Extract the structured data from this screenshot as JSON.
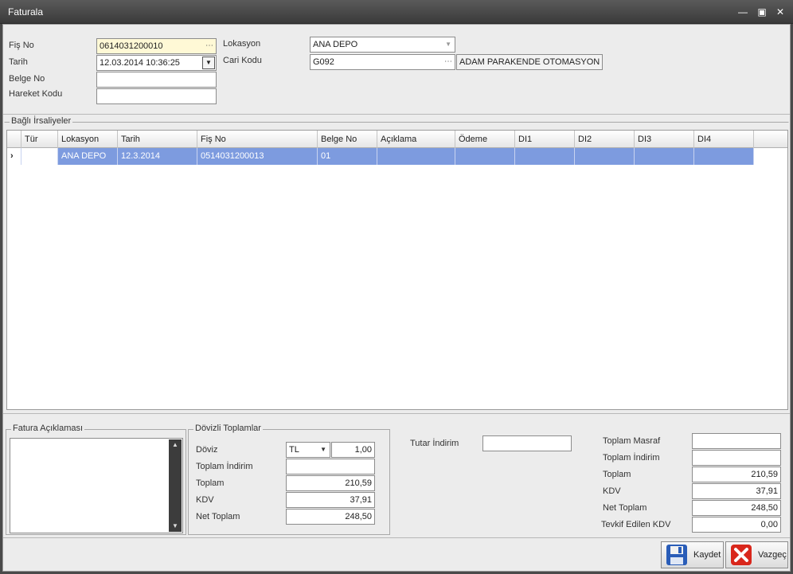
{
  "window": {
    "title": "Faturala"
  },
  "header": {
    "fis_no_label": "Fiş No",
    "fis_no_value": "0614031200010",
    "tarih_label": "Tarih",
    "tarih_value": "12.03.2014 10:36:25",
    "belge_no_label": "Belge No",
    "belge_no_value": "",
    "hareket_kodu_label": "Hareket Kodu",
    "hareket_kodu_value": "",
    "lokasyon_label": "Lokasyon",
    "lokasyon_value": "ANA DEPO",
    "cari_kodu_label": "Cari Kodu",
    "cari_kodu_value": "G092",
    "cari_adi_value": "ADAM PARAKENDE OTOMASYON ..."
  },
  "irsaliye": {
    "group_title": "Bağlı İrsaliyeler",
    "columns": [
      "Tür",
      "Lokasyon",
      "Tarih",
      "Fiş No",
      "Belge No",
      "Açıklama",
      "Ödeme",
      "DI1",
      "DI2",
      "DI3",
      "DI4"
    ],
    "rows": [
      {
        "indicator": "›",
        "tur": "",
        "lokasyon": "ANA DEPO",
        "tarih": "12.3.2014",
        "fis_no": "0514031200013",
        "belge_no": "01",
        "aciklama": "",
        "odeme": "",
        "di1": "",
        "di2": "",
        "di3": "",
        "di4": ""
      }
    ]
  },
  "aciklama": {
    "group_title": "Fatura Açıklaması",
    "value": ""
  },
  "dovizli": {
    "group_title": "Dövizli Toplamlar",
    "doviz_label": "Döviz",
    "doviz_value": "TL",
    "kur_value": "1,00",
    "toplam_indirim_label": "Toplam İndirim",
    "toplam_indirim_value": "",
    "toplam_label": "Toplam",
    "toplam_value": "210,59",
    "kdv_label": "KDV",
    "kdv_value": "37,91",
    "net_toplam_label": "Net Toplam",
    "net_toplam_value": "248,50"
  },
  "tutar_indirim": {
    "label": "Tutar İndirim",
    "value": ""
  },
  "totals": {
    "toplam_masraf_label": "Toplam Masraf",
    "toplam_masraf_value": "",
    "toplam_indirim_label": "Toplam İndirim",
    "toplam_indirim_value": "",
    "toplam_label": "Toplam",
    "toplam_value": "210,59",
    "kdv_label": "KDV",
    "kdv_value": "37,91",
    "net_toplam_label": "Net Toplam",
    "net_toplam_value": "248,50",
    "tevkif_label": "Tevkif Edilen KDV",
    "tevkif_value": "0,00"
  },
  "buttons": {
    "kaydet": "Kaydet",
    "vazgec": "Vazgeç"
  },
  "icons": {
    "minimize": "minimize-icon",
    "maximize": "maximize-icon",
    "close": "close-icon",
    "save": "floppy-disk-icon",
    "cancel": "cancel-x-icon"
  },
  "colors": {
    "selected_row": "#7d9bdf",
    "fis_no_bg": "#fff9d6",
    "title_bar": "#3c3c3c",
    "cancel_red": "#d9271c",
    "save_blue": "#2a5db8"
  }
}
